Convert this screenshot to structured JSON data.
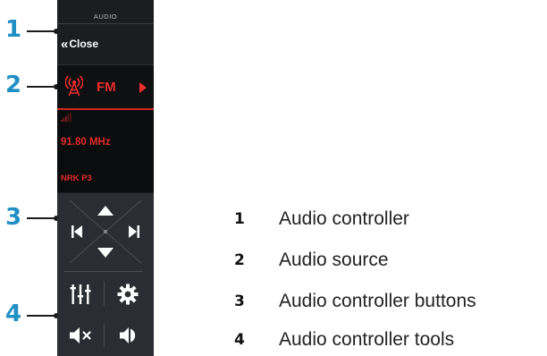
{
  "panel": {
    "title": "AUDIO",
    "close_label": "Close",
    "source_label": "FM",
    "frequency": "91.80 MHz",
    "station": "NRK P3"
  },
  "controls": {
    "buttons": [
      "up-icon",
      "down-icon",
      "skip-back-icon",
      "skip-forward-icon"
    ],
    "tools": [
      "equalizer-icon",
      "gear-icon",
      "mute-icon",
      "volume-icon"
    ]
  },
  "callouts": [
    "1",
    "2",
    "3",
    "4"
  ],
  "legend": [
    {
      "num": "1",
      "text": "Audio controller"
    },
    {
      "num": "2",
      "text": "Audio source"
    },
    {
      "num": "3",
      "text": "Audio controller buttons"
    },
    {
      "num": "4",
      "text": "Audio controller tools"
    }
  ],
  "colors": {
    "callout": "#1f8fc4",
    "accent_red": "#e02b2b",
    "panel_bg": "#1b1d20"
  }
}
